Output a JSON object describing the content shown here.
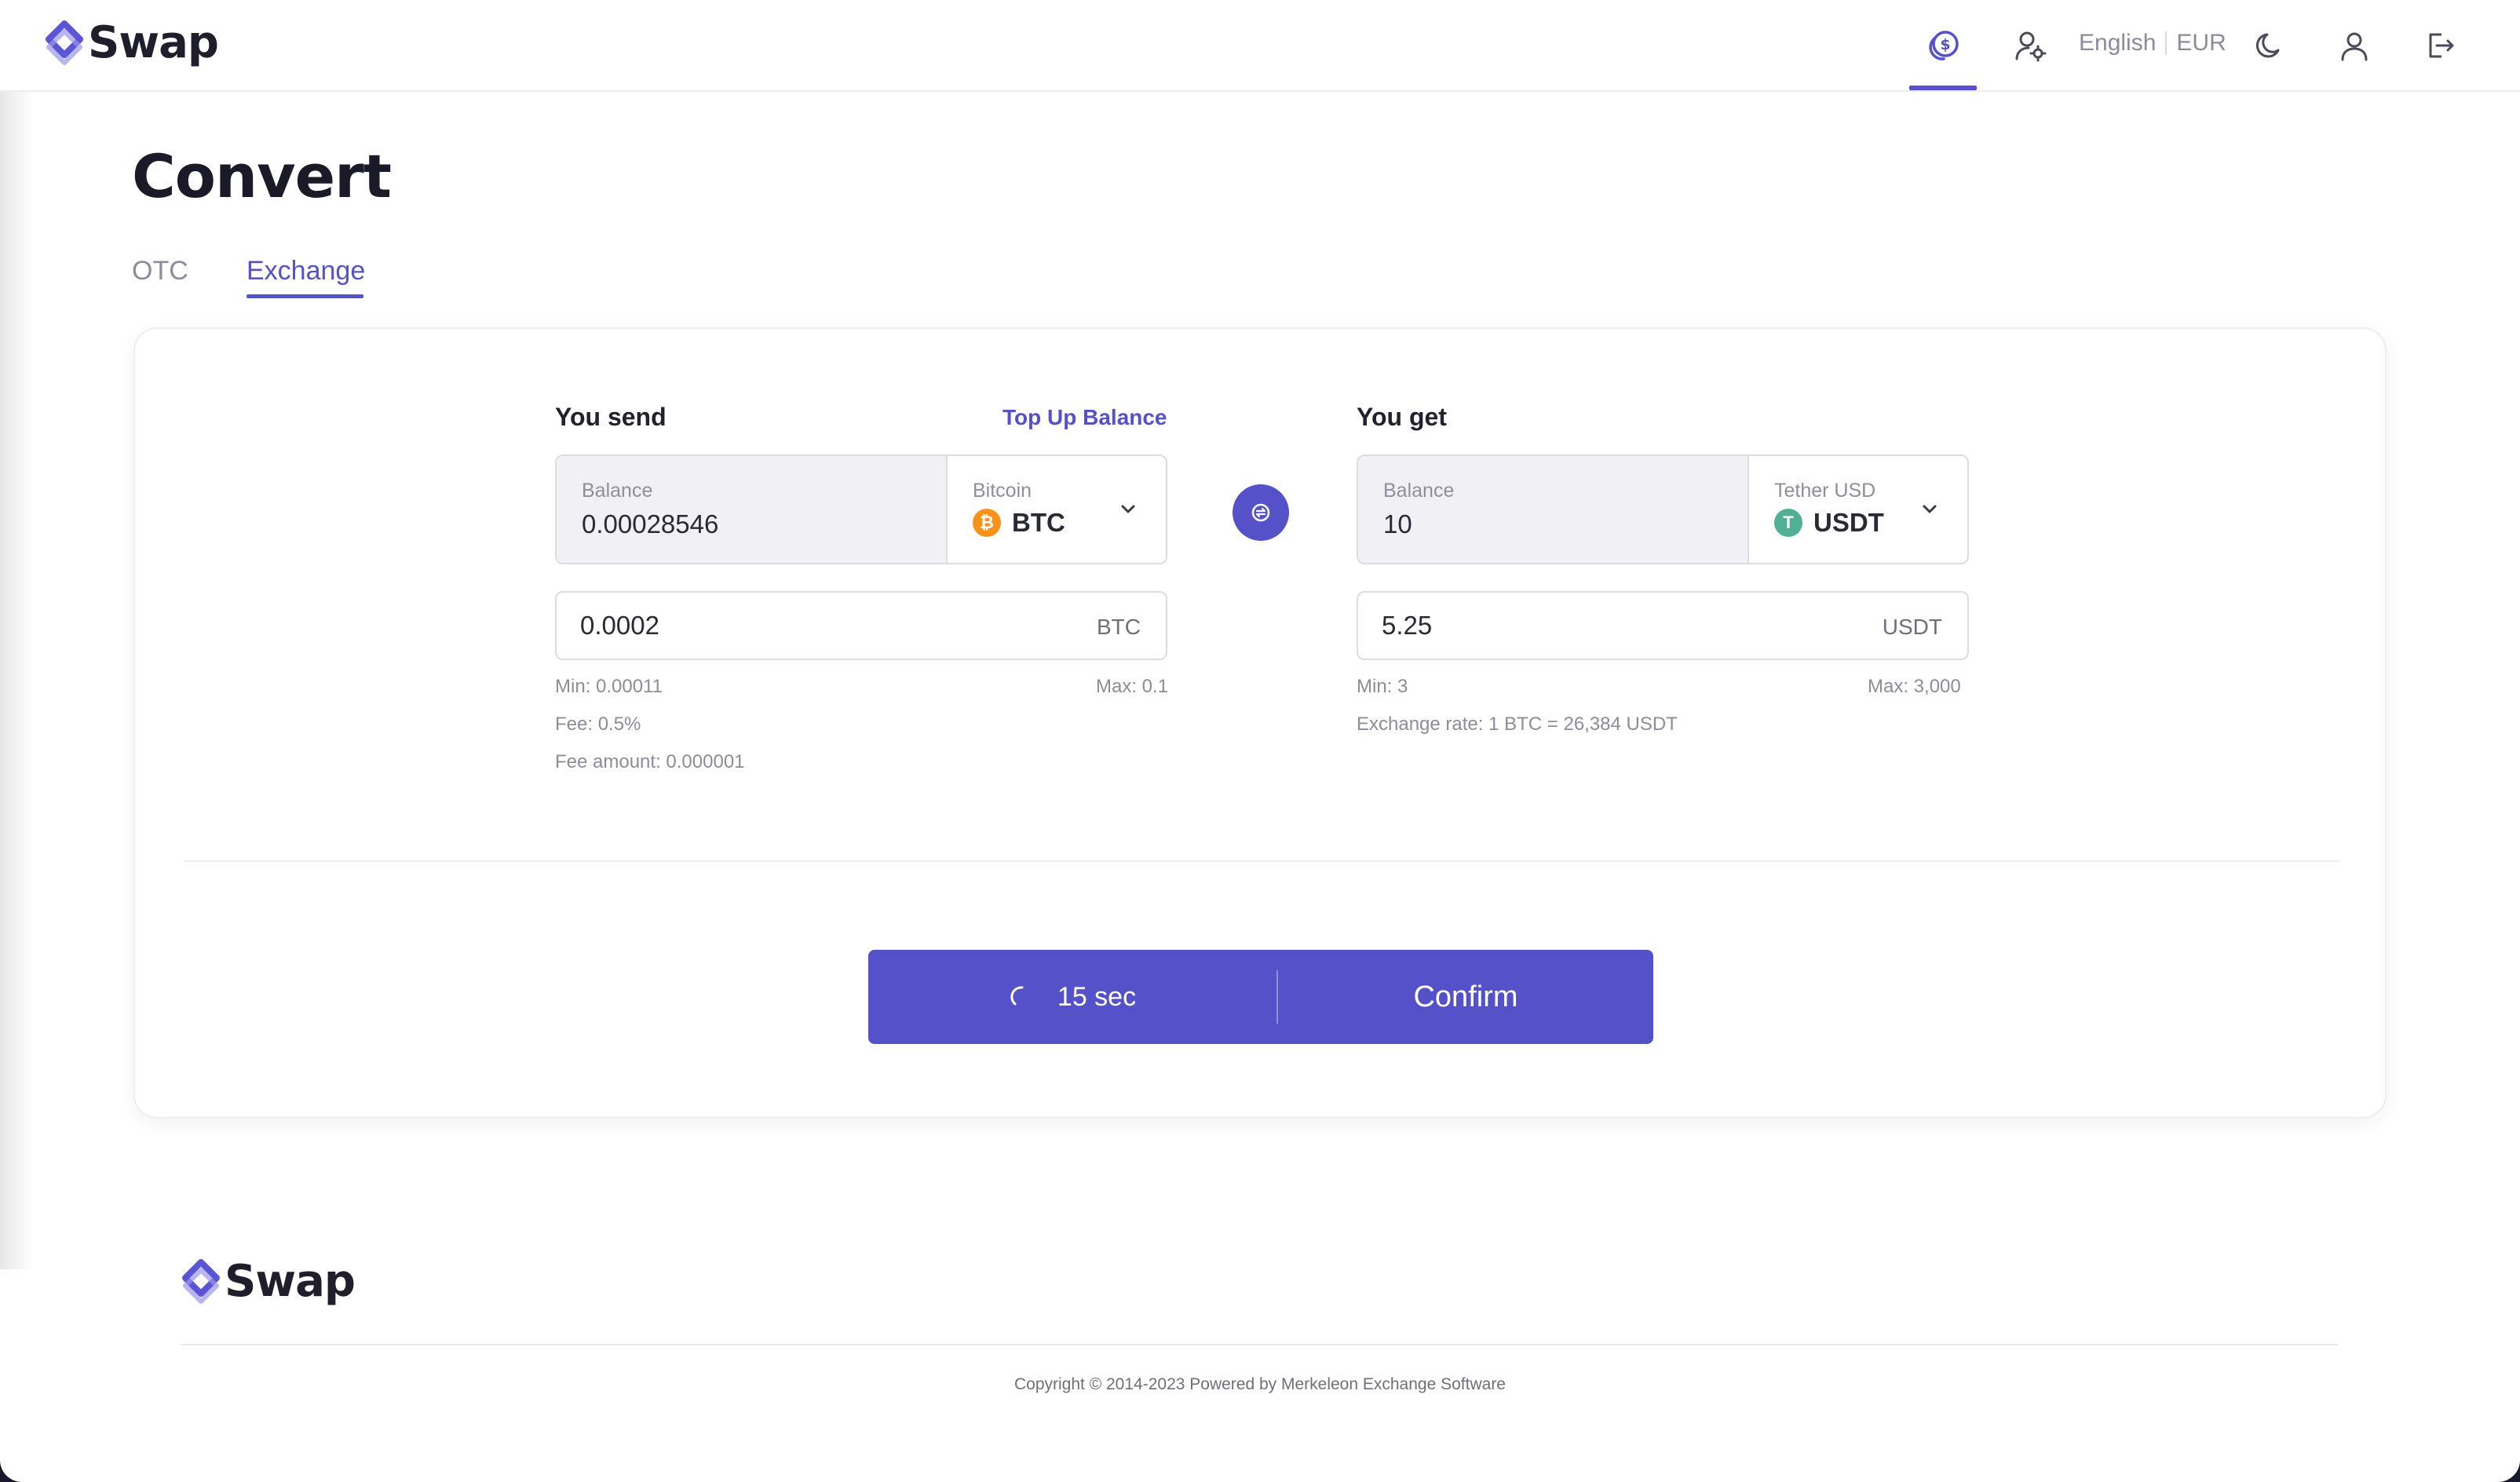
{
  "header": {
    "brand": "Swap",
    "language": "English",
    "currency": "EUR"
  },
  "page": {
    "title": "Convert",
    "tabs": [
      {
        "label": "OTC",
        "active": false
      },
      {
        "label": "Exchange",
        "active": true
      }
    ]
  },
  "send": {
    "label": "You send",
    "topup_link": "Top Up Balance",
    "balance_caption": "Balance",
    "balance": "0.00028546",
    "coin_name": "Bitcoin",
    "coin_symbol": "BTC",
    "coin_glyph": "₿",
    "amount": "0.0002",
    "unit": "BTC",
    "min": "Min: 0.00011",
    "max": "Max: 0.1",
    "fee": "Fee: 0.5%",
    "fee_amount": "Fee amount: 0.000001"
  },
  "get": {
    "label": "You get",
    "balance_caption": "Balance",
    "balance": "10",
    "coin_name": "Tether USD",
    "coin_symbol": "USDT",
    "coin_glyph": "T",
    "amount": "5.25",
    "unit": "USDT",
    "min": "Min: 3",
    "max": "Max: 3,000",
    "rate": "Exchange rate: 1 BTC = 26,384 USDT"
  },
  "confirm": {
    "timer": "15 sec",
    "label": "Confirm"
  },
  "footer": {
    "brand": "Swap",
    "copyright": "Copyright © 2014-2023 Powered by Merkeleon Exchange Software"
  },
  "colors": {
    "accent": "#5551c9",
    "btc": "#f7931a",
    "usdt": "#50af95"
  }
}
